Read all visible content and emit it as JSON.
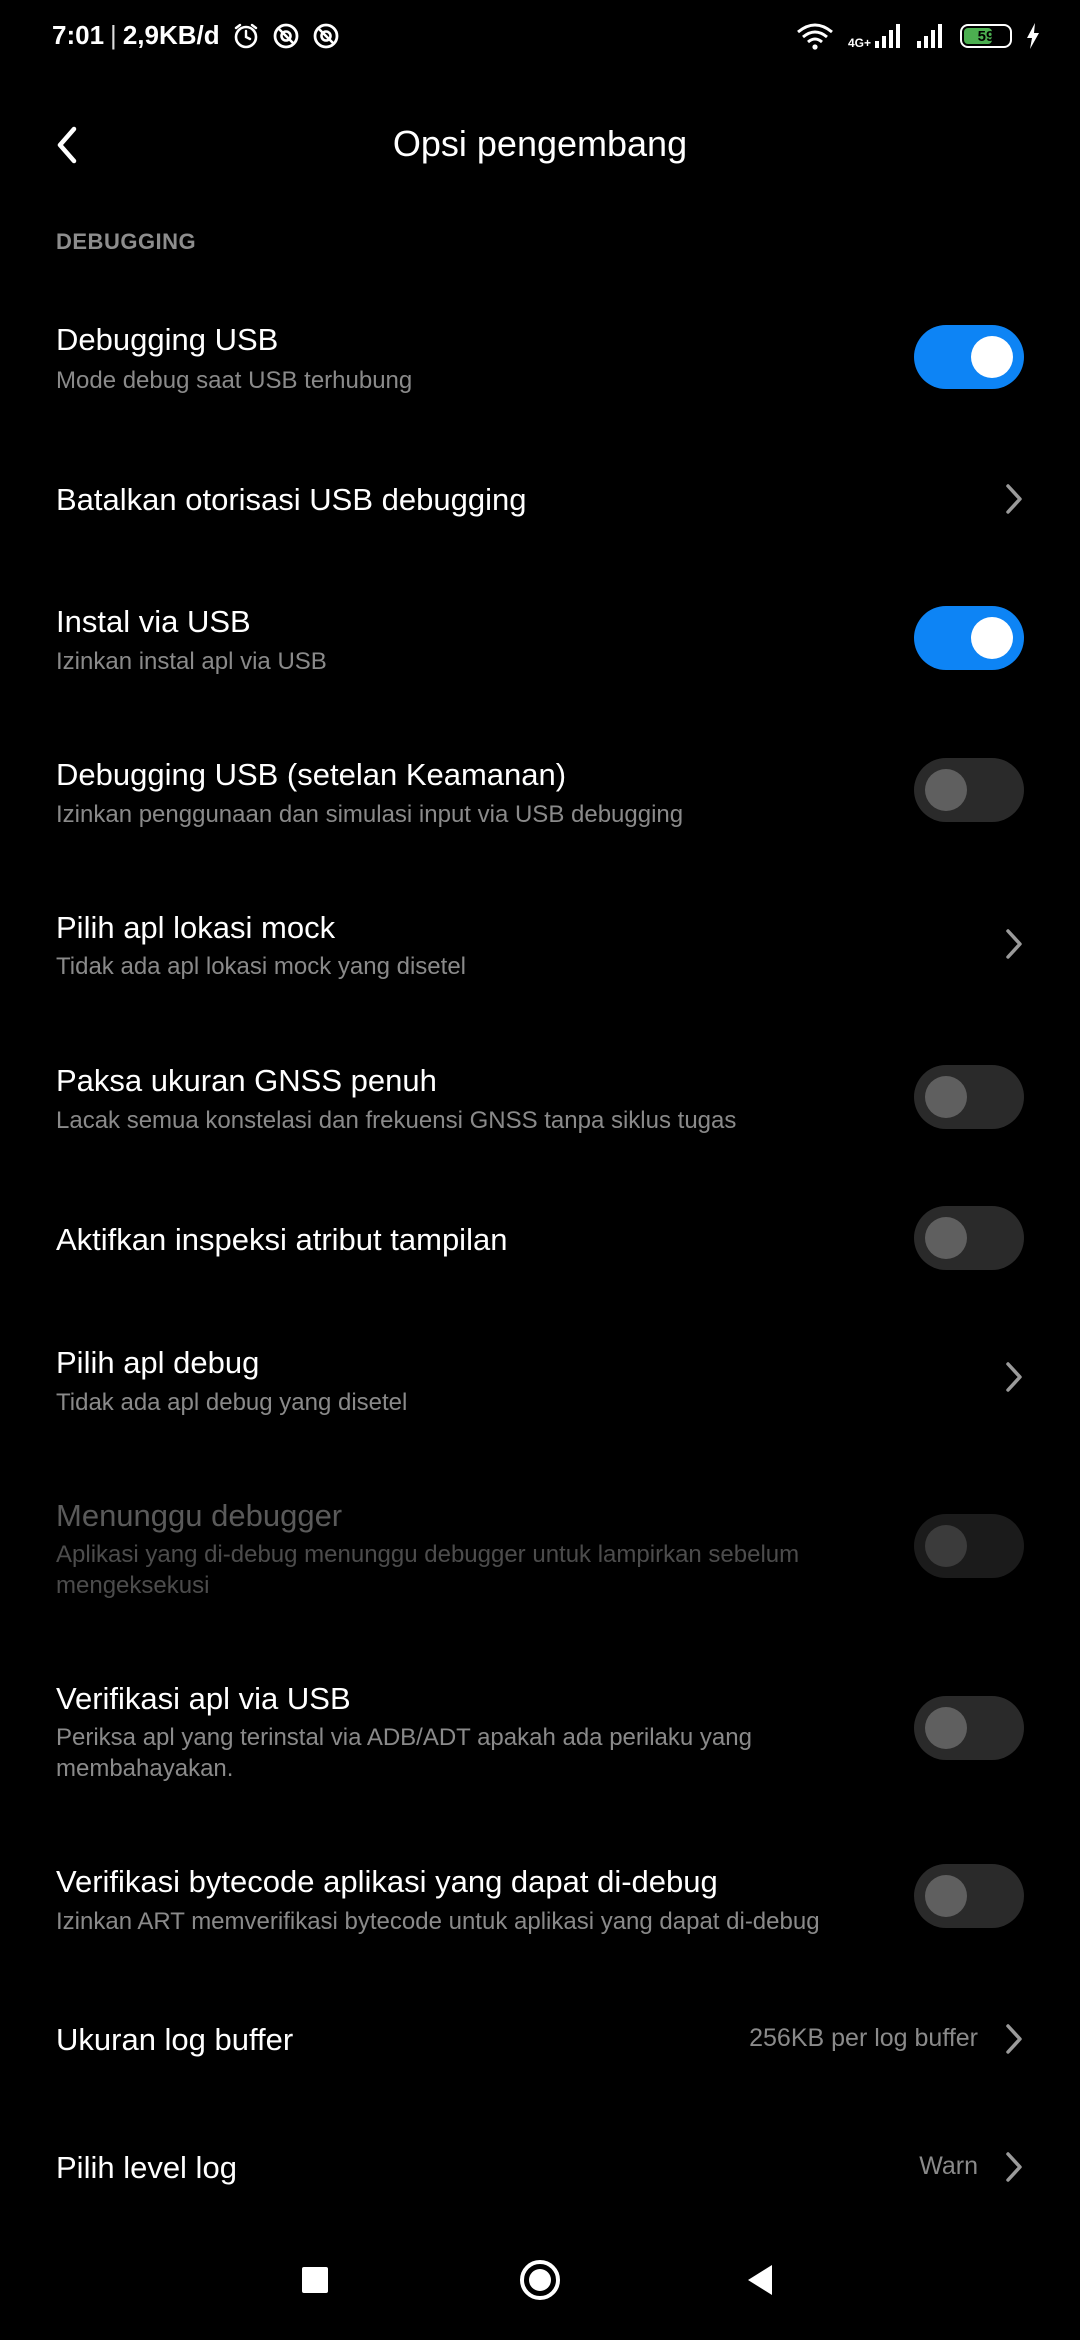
{
  "status_bar": {
    "time": "7:01",
    "separator": "|",
    "speed": "2,9KB/d",
    "network_label_top": "4G+",
    "network_label_bottom": "",
    "battery_level": "59"
  },
  "header": {
    "title": "Opsi pengembang"
  },
  "section": {
    "title": "DEBUGGING"
  },
  "rows": [
    {
      "title": "Debugging USB",
      "subtitle": "Mode debug saat USB terhubung",
      "control": "toggle",
      "on": true
    },
    {
      "title": "Batalkan otorisasi USB debugging",
      "control": "chevron"
    },
    {
      "title": "Instal via USB",
      "subtitle": "Izinkan instal apl via USB",
      "control": "toggle",
      "on": true
    },
    {
      "title": "Debugging USB (setelan Keamanan)",
      "subtitle": "Izinkan penggunaan dan simulasi input via USB debugging",
      "control": "toggle",
      "on": false
    },
    {
      "title": "Pilih apl lokasi mock",
      "subtitle": "Tidak ada apl lokasi mock yang disetel",
      "control": "chevron"
    },
    {
      "title": "Paksa ukuran GNSS penuh",
      "subtitle": "Lacak semua konstelasi dan frekuensi GNSS tanpa siklus tugas",
      "control": "toggle",
      "on": false
    },
    {
      "title": "Aktifkan inspeksi atribut tampilan",
      "control": "toggle",
      "on": false
    },
    {
      "title": "Pilih apl debug",
      "subtitle": "Tidak ada apl debug yang disetel",
      "control": "chevron"
    },
    {
      "title": "Menunggu debugger",
      "subtitle": "Aplikasi yang di-debug menunggu debugger untuk lampirkan sebelum mengeksekusi",
      "control": "toggle",
      "on": false,
      "disabled": true
    },
    {
      "title": "Verifikasi apl via USB",
      "subtitle": "Periksa apl yang terinstal via ADB/ADT apakah ada perilaku yang membahayakan.",
      "control": "toggle",
      "on": false
    },
    {
      "title": "Verifikasi bytecode aplikasi yang dapat di-debug",
      "subtitle": "Izinkan ART memverifikasi bytecode untuk aplikasi yang dapat di-debug",
      "control": "toggle",
      "on": false
    },
    {
      "title": "Ukuran log buffer",
      "value": "256KB per log buffer",
      "control": "chevron"
    },
    {
      "title": "Pilih level log",
      "value": "Warn",
      "control": "chevron"
    }
  ],
  "colors": {
    "accent": "#0d84f5",
    "background": "#000000",
    "subtitle": "#8a8a8a"
  },
  "nav": {
    "recents_icon": "square-icon",
    "home_icon": "circle-icon",
    "back_icon": "triangle-icon"
  }
}
